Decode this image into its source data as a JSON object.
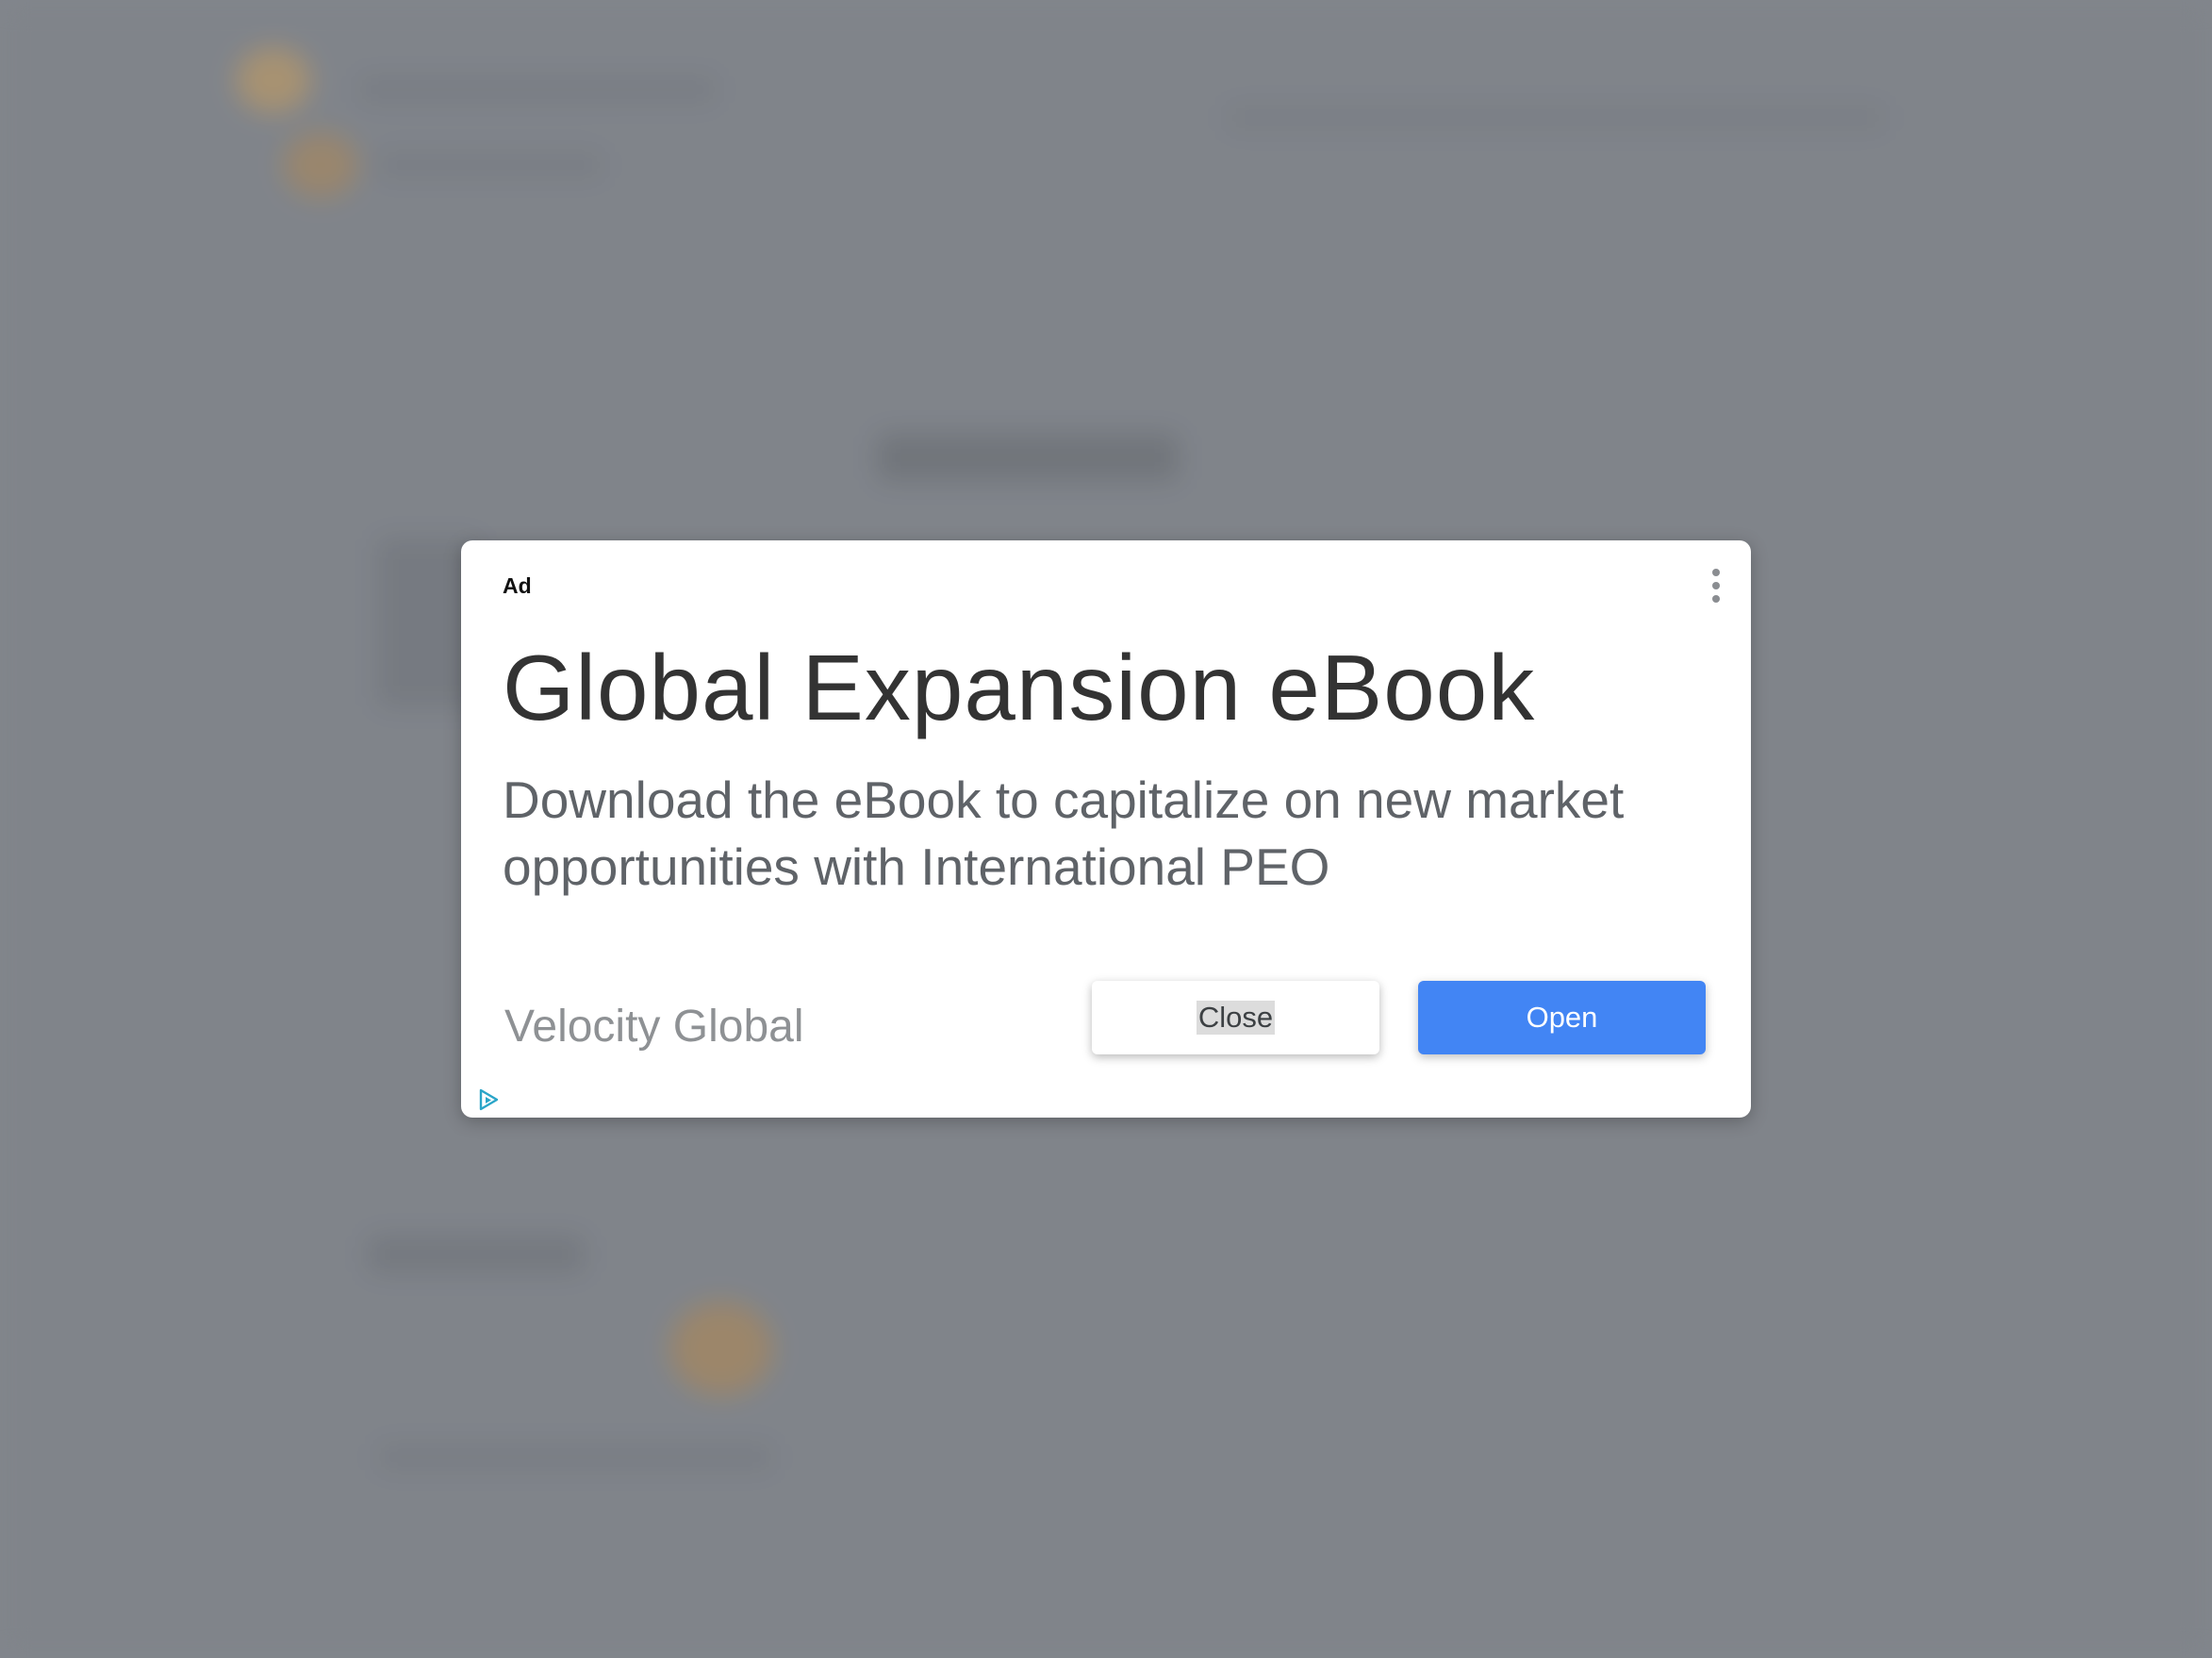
{
  "ad": {
    "label": "Ad",
    "headline": "Global Expansion eBook",
    "description": "Download the eBook to capitalize on new market opportunities with International PEO",
    "advertiser": "Velocity Global",
    "close_label": "Close",
    "open_label": "Open",
    "menu_icon": "more-vert-icon",
    "adchoices_icon": "adchoices-icon"
  },
  "colors": {
    "overlay": "#868a90",
    "open_button": "#4285f4",
    "headline": "#333333",
    "description": "#5f6368",
    "advertiser": "#8e9194",
    "adchoices": "#2aa5c8"
  }
}
